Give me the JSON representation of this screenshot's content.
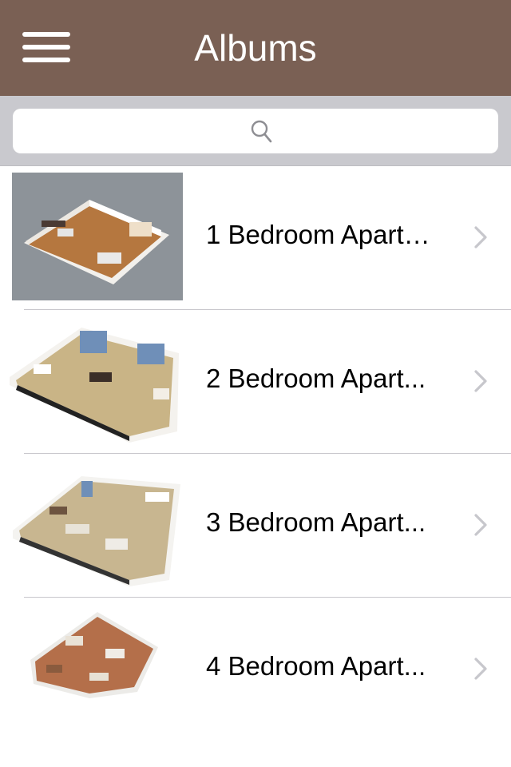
{
  "nav": {
    "title": "Albums",
    "menu_icon": "hamburger-menu-icon"
  },
  "search": {
    "icon": "search-icon",
    "placeholder": ""
  },
  "albums": [
    {
      "label": "1 Bedroom Apartm..."
    },
    {
      "label": "2 Bedroom Apart..."
    },
    {
      "label": "3 Bedroom Apart..."
    },
    {
      "label": "4 Bedroom Apart..."
    }
  ],
  "colors": {
    "navbar": "#7a6054",
    "search_bg": "#c9c9ce",
    "chevron": "#c7c7cc"
  }
}
